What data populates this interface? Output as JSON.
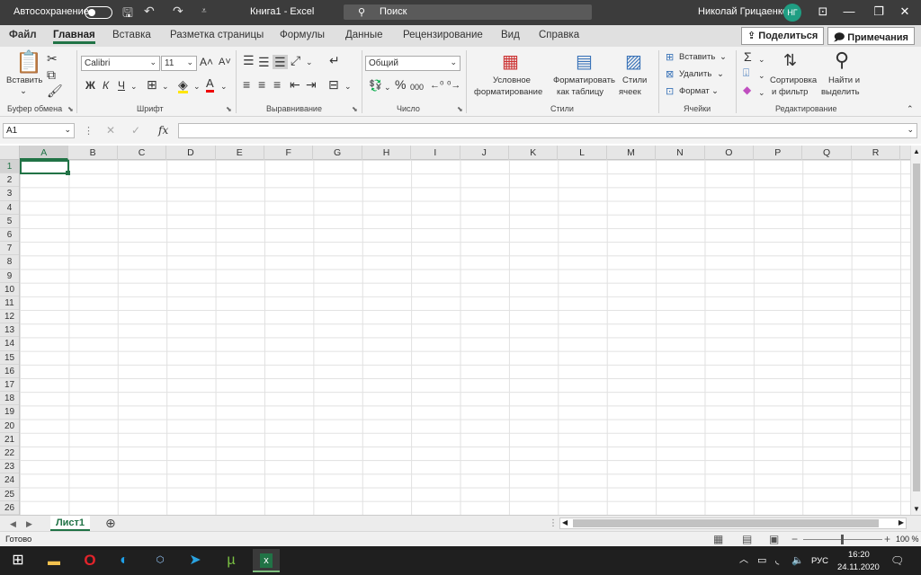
{
  "titlebar": {
    "autosave": "Автосохранение",
    "doc_title": "Книга1  -  Excel",
    "search_placeholder": "Поиск",
    "user_name": "Николай Грицаенко",
    "user_initials": "НГ"
  },
  "tabs": [
    {
      "label": "Файл"
    },
    {
      "label": "Главная"
    },
    {
      "label": "Вставка"
    },
    {
      "label": "Разметка страницы"
    },
    {
      "label": "Формулы"
    },
    {
      "label": "Данные"
    },
    {
      "label": "Рецензирование"
    },
    {
      "label": "Вид"
    },
    {
      "label": "Справка"
    }
  ],
  "share": "Поделиться",
  "comments": "Примечания",
  "ribbon": {
    "clipboard": {
      "paste": "Вставить",
      "group": "Буфер обмена"
    },
    "font": {
      "name": "Calibri",
      "size": "11",
      "group": "Шрифт",
      "bold": "Ж",
      "italic": "К",
      "underline": "Ч"
    },
    "alignment": {
      "group": "Выравнивание"
    },
    "number": {
      "format": "Общий",
      "group": "Число",
      "percent": "%",
      "thousands": "000"
    },
    "styles": {
      "conditional1": "Условное",
      "conditional2": "форматирование",
      "table1": "Форматировать",
      "table2": "как таблицу",
      "cell1": "Стили",
      "cell2": "ячеек",
      "group": "Стили"
    },
    "cells": {
      "insert": "Вставить",
      "delete": "Удалить",
      "format": "Формат",
      "group": "Ячейки"
    },
    "editing": {
      "sort1": "Сортировка",
      "sort2": "и фильтр",
      "find1": "Найти и",
      "find2": "выделить",
      "group": "Редактирование"
    }
  },
  "formula": {
    "namebox": "A1",
    "fx": "fx"
  },
  "columns": [
    "A",
    "B",
    "C",
    "D",
    "E",
    "F",
    "G",
    "H",
    "I",
    "J",
    "K",
    "L",
    "M",
    "N",
    "O",
    "P",
    "Q",
    "R"
  ],
  "rows": [
    "1",
    "2",
    "3",
    "4",
    "5",
    "6",
    "7",
    "8",
    "9",
    "10",
    "11",
    "12",
    "13",
    "14",
    "15",
    "16",
    "17",
    "18",
    "19",
    "20",
    "21",
    "22",
    "23",
    "24",
    "25",
    "26"
  ],
  "sheet": {
    "name": "Лист1"
  },
  "status": {
    "ready": "Готово",
    "zoom": "100 %"
  },
  "taskbar": {
    "lang": "РУС",
    "time": "16:20",
    "date": "24.11.2020"
  },
  "colors": {
    "accent": "#217346",
    "titlebar": "#3c3c3c"
  }
}
